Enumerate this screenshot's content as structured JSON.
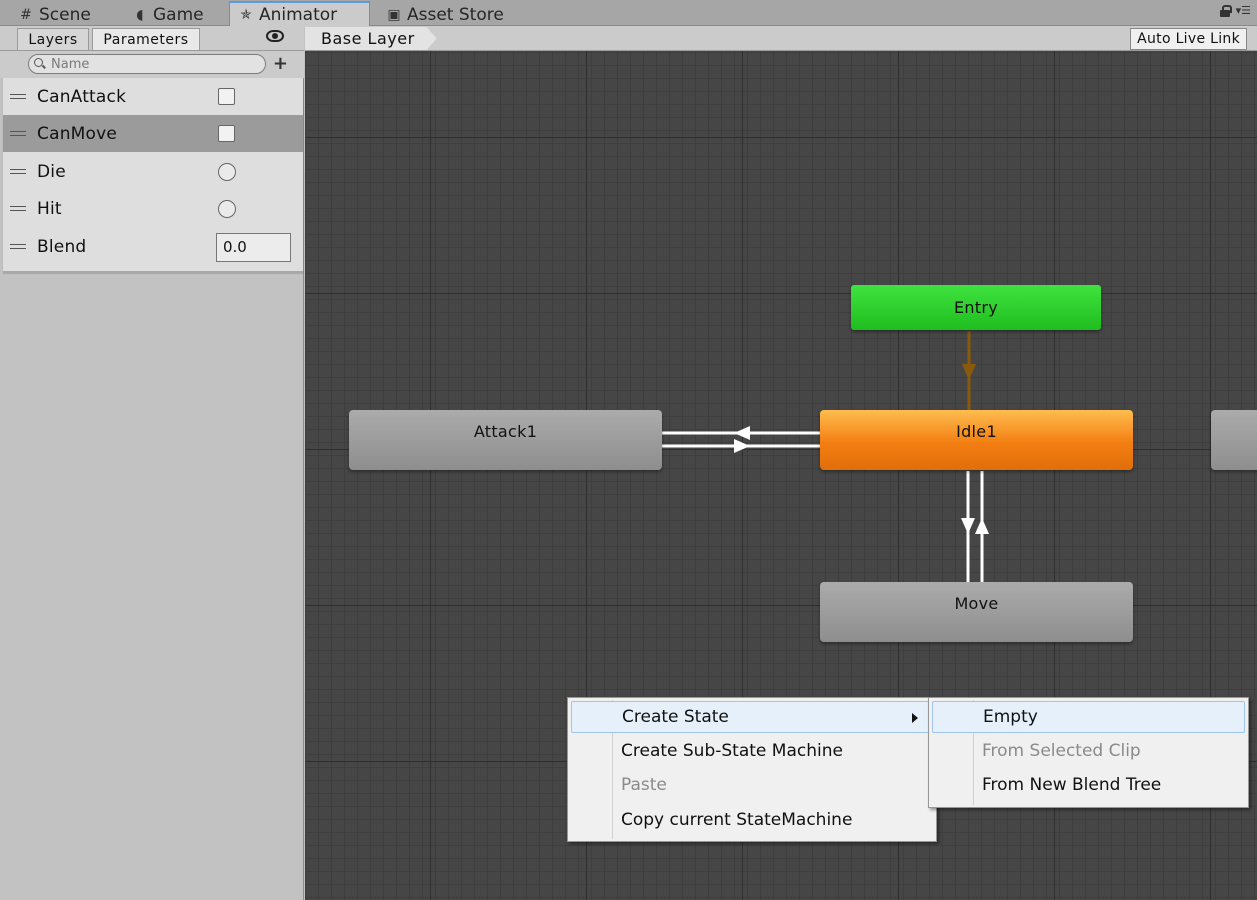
{
  "tabs": [
    {
      "label": "Scene",
      "icon": "grid-icon"
    },
    {
      "label": "Game",
      "icon": "pacman-icon"
    },
    {
      "label": "Animator",
      "icon": "animator-icon"
    },
    {
      "label": "Asset Store",
      "icon": "store-icon"
    }
  ],
  "active_tab": "Animator",
  "left": {
    "tabs": [
      "Layers",
      "Parameters"
    ],
    "selected_tab": "Parameters",
    "search": {
      "placeholder": "Name",
      "value": ""
    },
    "parameters": [
      {
        "name": "CanAttack",
        "type": "bool",
        "value": false,
        "selected": false
      },
      {
        "name": "CanMove",
        "type": "bool",
        "value": false,
        "selected": true
      },
      {
        "name": "Die",
        "type": "trigger",
        "selected": false
      },
      {
        "name": "Hit",
        "type": "trigger",
        "selected": false
      },
      {
        "name": "Blend",
        "type": "float",
        "value": "0.0",
        "selected": false
      }
    ]
  },
  "graph": {
    "breadcrumb": "Base Layer",
    "live_link_label": "Auto Live Link",
    "states": [
      {
        "name": "Entry",
        "kind": "entry"
      },
      {
        "name": "Attack1",
        "kind": "state"
      },
      {
        "name": "Idle1",
        "kind": "default"
      },
      {
        "name": "Move",
        "kind": "state"
      }
    ],
    "colors": {
      "entry": "#2ad22a",
      "default": "#f28a1a",
      "state": "#9d9d9d",
      "entry_transition": "#8a5a0a",
      "transition": "#ffffff"
    }
  },
  "context_menu": {
    "items": [
      {
        "label": "Create State",
        "disabled": false,
        "highlighted": true,
        "submenu": true
      },
      {
        "label": "Create Sub-State Machine",
        "disabled": false
      },
      {
        "label": "Paste",
        "disabled": true
      },
      {
        "label": "Copy current StateMachine",
        "disabled": false
      }
    ],
    "submenu": [
      {
        "label": "Empty",
        "disabled": false,
        "highlighted": true
      },
      {
        "label": "From Selected Clip",
        "disabled": true
      },
      {
        "label": "From New Blend Tree",
        "disabled": false
      }
    ]
  }
}
